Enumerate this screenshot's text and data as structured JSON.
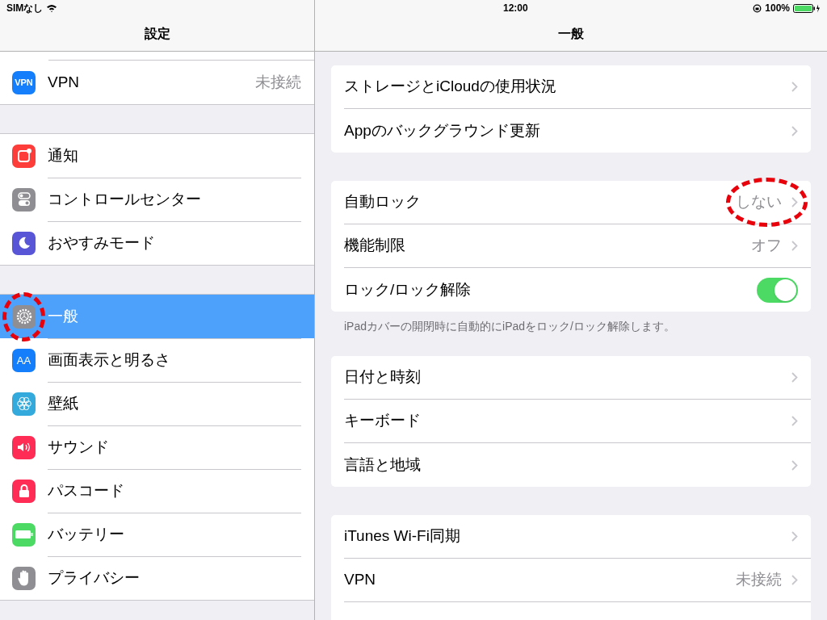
{
  "status_bar": {
    "carrier": "SIMなし",
    "time": "12:00",
    "battery": "100%"
  },
  "sidebar": {
    "title": "設定",
    "groups": [
      {
        "items": [
          {
            "icon_text": "VPN",
            "label": "VPN",
            "value": "未接続",
            "selected": false,
            "highlight": false
          }
        ]
      },
      {
        "items": [
          {
            "label": "通知",
            "selected": false,
            "highlight": false
          },
          {
            "label": "コントロールセンター",
            "selected": false,
            "highlight": false
          },
          {
            "label": "おやすみモード",
            "selected": false,
            "highlight": false
          }
        ]
      },
      {
        "items": [
          {
            "label": "一般",
            "selected": true,
            "highlight": true
          },
          {
            "icon_text": "AA",
            "label": "画面表示と明るさ",
            "selected": false,
            "highlight": false
          },
          {
            "label": "壁紙",
            "selected": false,
            "highlight": false
          },
          {
            "label": "サウンド",
            "selected": false,
            "highlight": false
          },
          {
            "label": "パスコード",
            "selected": false,
            "highlight": false
          },
          {
            "label": "バッテリー",
            "selected": false,
            "highlight": false
          },
          {
            "label": "プライバシー",
            "selected": false,
            "highlight": false
          }
        ]
      }
    ]
  },
  "detail": {
    "title": "一般",
    "groups": [
      {
        "rows": [
          {
            "kind": "link",
            "label": "ストレージとiCloudの使用状況",
            "highlight": false
          },
          {
            "kind": "link",
            "label": "Appのバックグラウンド更新",
            "highlight": false
          }
        ]
      },
      {
        "rows": [
          {
            "kind": "link",
            "label": "自動ロック",
            "value": "しない",
            "highlight": true
          },
          {
            "kind": "link",
            "label": "機能制限",
            "value": "オフ",
            "highlight": false
          },
          {
            "kind": "toggle",
            "label": "ロック/ロック解除",
            "on": true,
            "highlight": false
          }
        ],
        "footer": "iPadカバーの開閉時に自動的にiPadをロック/ロック解除します。"
      },
      {
        "rows": [
          {
            "kind": "link",
            "label": "日付と時刻",
            "highlight": false
          },
          {
            "kind": "link",
            "label": "キーボード",
            "highlight": false
          },
          {
            "kind": "link",
            "label": "言語と地域",
            "highlight": false
          }
        ]
      },
      {
        "rows": [
          {
            "kind": "link",
            "label": "iTunes Wi-Fi同期",
            "highlight": false
          },
          {
            "kind": "link",
            "label": "VPN",
            "value": "未接続",
            "highlight": false
          },
          {
            "kind": "stub"
          }
        ]
      }
    ]
  }
}
